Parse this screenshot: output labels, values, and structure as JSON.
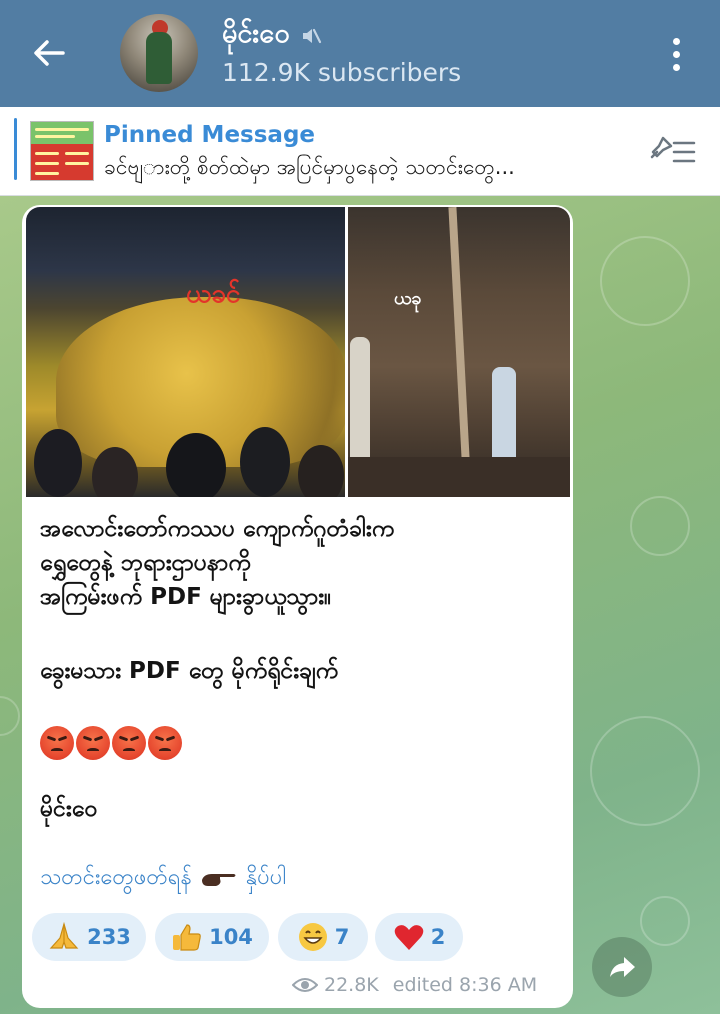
{
  "header": {
    "channel_name": "မိုင်း၀ေ",
    "subscribers": "112.9K subscribers",
    "back_icon": "arrow-left-icon",
    "mute_icon": "speaker-muted-icon",
    "menu_icon": "more-vertical-icon"
  },
  "pinned": {
    "label": "Pinned Message",
    "text": "ခင်ဗျ​ားတို့ စိတ်ထဲမှာ အပြင်မှာပွနေတဲ့ သတင်းတွေ..."
  },
  "message": {
    "photo_label_1": "ယခင်",
    "photo_label_2": "ယခု",
    "line1": "အလောင်းတော်ကဿပ ကျောက်ဂူတံခါးက",
    "line2": "ရွှေတွေနဲ့ ဘုရားဌာပနာကို",
    "line3": "အကြမ်းဖက် PDF များခွာယူသွား။",
    "line4": "ခွေးမသား PDF တွေ မိုက်ရိုင်းချက်",
    "signature": "မိုင်း၀ေ",
    "link_text": "သတင်းတွေဖတ်ရန်",
    "link_text_2": "နှိပ်ပါ"
  },
  "reactions": [
    {
      "icon": "folded-hands-icon",
      "count": "233"
    },
    {
      "icon": "thumbs-up-icon",
      "count": "104"
    },
    {
      "icon": "grinning-face-icon",
      "count": "7"
    },
    {
      "icon": "red-heart-icon",
      "count": "2"
    }
  ],
  "footer": {
    "views": "22.8K",
    "edited": "edited 8:36 AM"
  },
  "colors": {
    "header_bg": "#527da3",
    "link": "#3a83c8",
    "reaction_bg": "#e3eff9"
  }
}
